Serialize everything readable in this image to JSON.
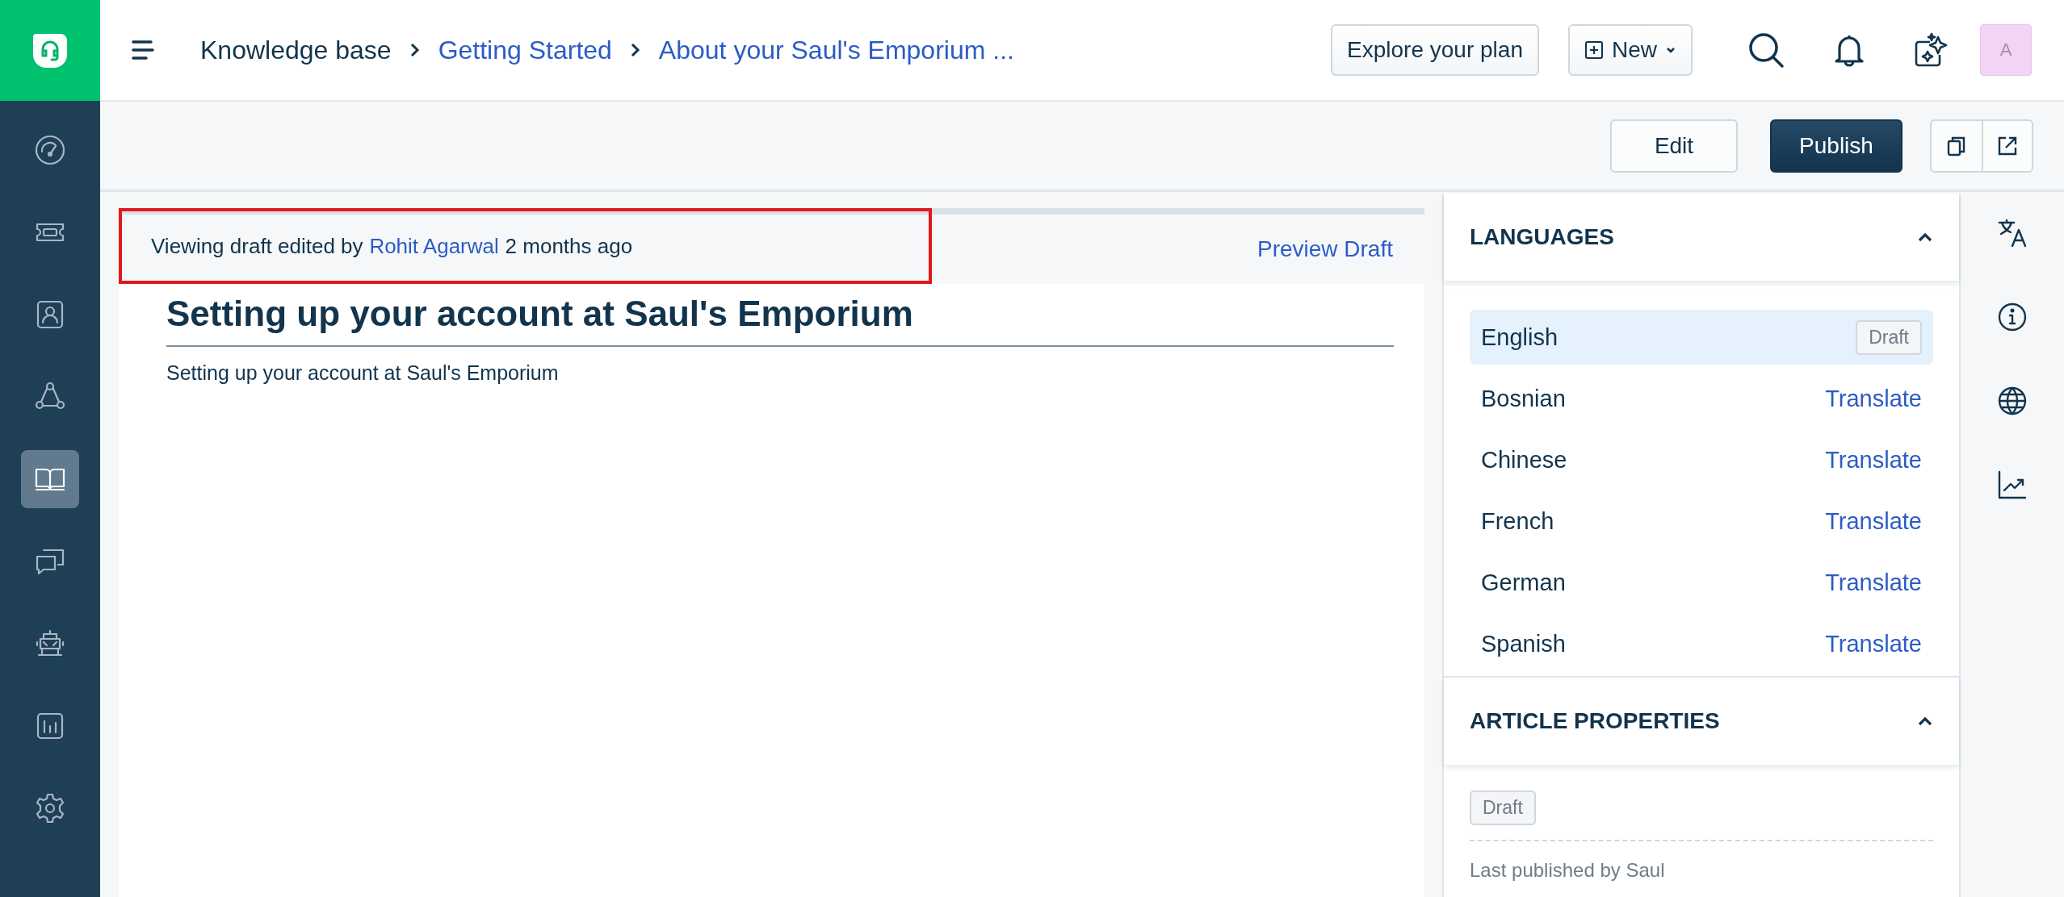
{
  "sidebar": {
    "items": [
      {
        "kind": "dashboard",
        "selected": false
      },
      {
        "kind": "ticket",
        "selected": false
      },
      {
        "kind": "contact",
        "selected": false
      },
      {
        "kind": "network",
        "selected": false
      },
      {
        "kind": "book",
        "selected": true
      },
      {
        "kind": "chat",
        "selected": false
      },
      {
        "kind": "robot",
        "selected": false
      },
      {
        "kind": "reports",
        "selected": false
      },
      {
        "kind": "settings",
        "selected": false
      }
    ]
  },
  "breadcrumb": [
    {
      "label": "Knowledge base",
      "kind": "current"
    },
    {
      "label": "Getting Started",
      "kind": "link"
    },
    {
      "label": "About your Saul's Emporium ...",
      "kind": "link"
    }
  ],
  "header_actions": {
    "explore": "Explore your plan",
    "new": "New",
    "avatar": "A"
  },
  "toolbar": {
    "edit": "Edit",
    "publish": "Publish"
  },
  "banner": {
    "prefix": "Viewing draft edited by",
    "author": "Rohit Agarwal",
    "suffix": "2 months ago",
    "action": "Preview Draft",
    "highlighted": true
  },
  "article": {
    "title": "Setting up your account at Saul's Emporium",
    "body": "Setting up your account at Saul's Emporium"
  },
  "languages": {
    "title": "LANGUAGES",
    "expanded": true,
    "items": [
      {
        "name": "English",
        "selected": true,
        "status": "Draft"
      },
      {
        "name": "Bosnian",
        "selected": false,
        "action": "Translate"
      },
      {
        "name": "Chinese",
        "selected": false,
        "action": "Translate"
      },
      {
        "name": "French",
        "selected": false,
        "action": "Translate"
      },
      {
        "name": "German",
        "selected": false,
        "action": "Translate"
      },
      {
        "name": "Spanish",
        "selected": false,
        "action": "Translate"
      }
    ]
  },
  "article_properties": {
    "title": "ARTICLE PROPERTIES",
    "expanded": true,
    "status": "Draft",
    "last_published": "Last published by Saul"
  },
  "rail": [
    {
      "kind": "translate"
    },
    {
      "kind": "info"
    },
    {
      "kind": "globe"
    },
    {
      "kind": "chart"
    }
  ]
}
